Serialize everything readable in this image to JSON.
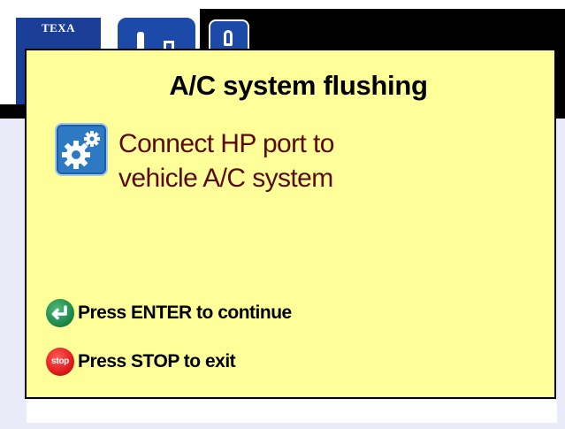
{
  "app": {
    "logo_text": "TEXA"
  },
  "dialog": {
    "title": "A/C system flushing",
    "message_line1": "Connect HP port to",
    "message_line2": "vehicle A/C system",
    "status_icon": "gears-icon",
    "actions": [
      {
        "icon": "enter-icon",
        "icon_text": "",
        "label": "Press ENTER to continue"
      },
      {
        "icon": "stop-icon",
        "icon_text": "stop",
        "label": "Press STOP to exit"
      }
    ]
  },
  "colors": {
    "dialog_background": "#ffff99",
    "message_text": "#5a0a0a",
    "brand_blue": "#1b3f96",
    "enter_green": "#1f8a4c",
    "stop_red": "#e01c1c"
  }
}
